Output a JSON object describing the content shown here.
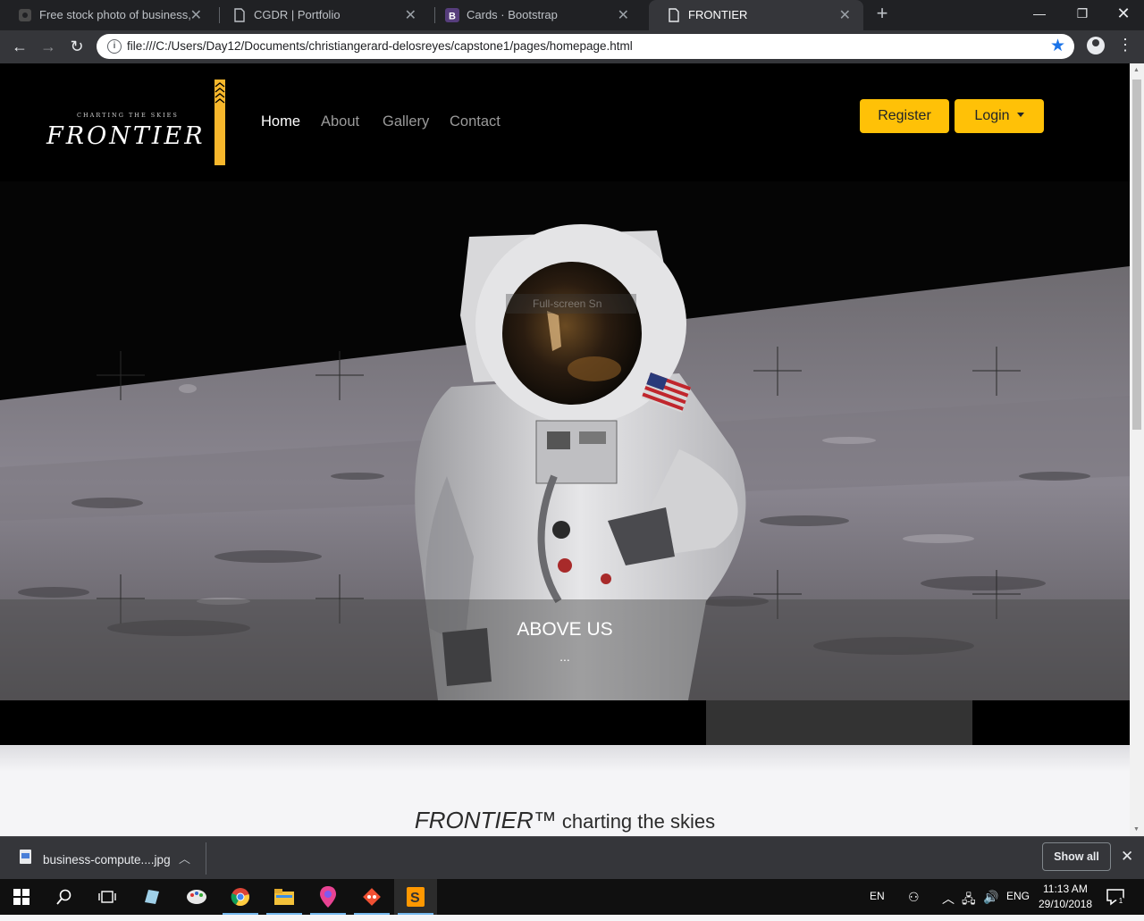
{
  "browser": {
    "tabs": [
      {
        "title": "Free stock photo of business, computer",
        "icon": "pexels-favicon",
        "active": false
      },
      {
        "title": "CGDR | Portfolio",
        "icon": "page-icon",
        "active": false
      },
      {
        "title": "Cards · Bootstrap",
        "icon": "bootstrap-icon",
        "active": false
      },
      {
        "title": "FRONTIER",
        "icon": "page-icon",
        "active": true
      }
    ],
    "address": "file:///C:/Users/Day12/Documents/christiangerard-delosreyes/capstone1/pages/homepage.html"
  },
  "site": {
    "brand": {
      "tagline": "CHARTING THE SKIES",
      "name": "FRONTIER",
      "accent": "#f7b72c"
    },
    "nav": [
      {
        "label": "Home",
        "active": true
      },
      {
        "label": "About",
        "active": false
      },
      {
        "label": "Gallery",
        "active": false
      },
      {
        "label": "Contact",
        "active": false
      }
    ],
    "buttons": {
      "register": "Register",
      "login": "Login",
      "color": "#ffc107"
    },
    "hero": {
      "caption_title": "ABOVE US",
      "caption_text": "...",
      "tooltip": "Full-screen Sn"
    },
    "tagline": {
      "brand": "FRONTIER™",
      "rest": " charting the skies"
    }
  },
  "downloads": {
    "file": "business-compute....jpg",
    "show_all": "Show all"
  },
  "taskbar": {
    "apps": [
      "start",
      "search",
      "task-view",
      "app-1",
      "paint",
      "chrome",
      "file-explorer",
      "maps",
      "git",
      "sublime-text"
    ],
    "lang": "EN",
    "input": "ENG",
    "time": "11:13 AM",
    "date": "29/10/2018",
    "notifications": "1"
  }
}
